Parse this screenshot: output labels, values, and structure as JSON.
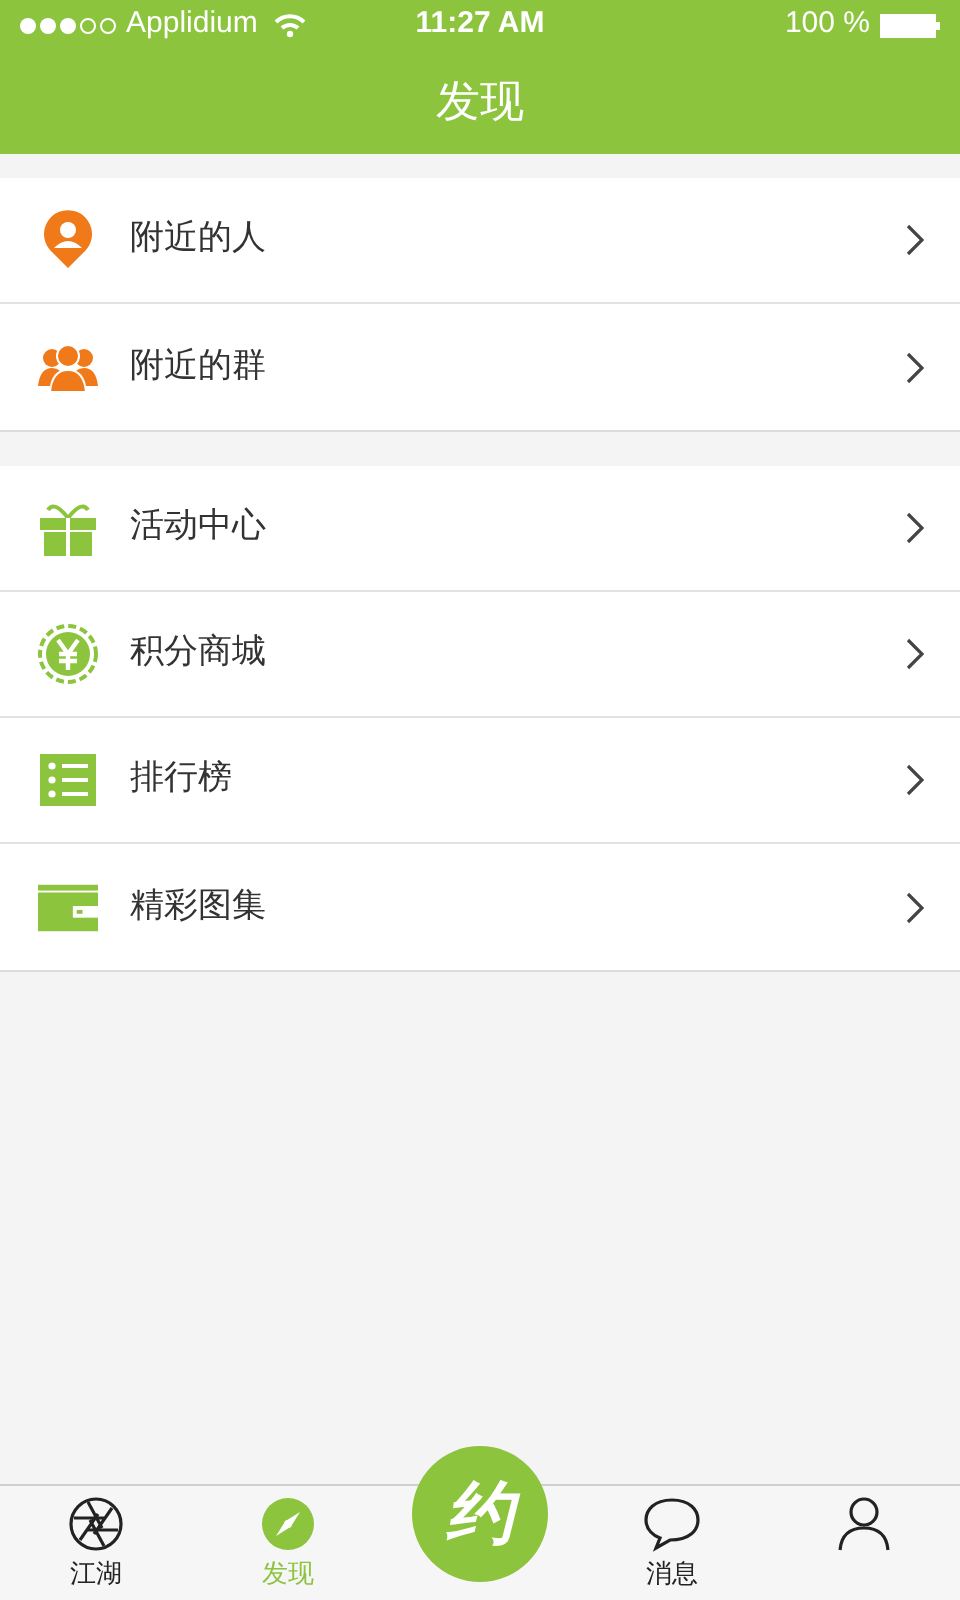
{
  "status_bar": {
    "carrier": "Applidium",
    "time": "11:27 AM",
    "battery": "100 %"
  },
  "nav_bar": {
    "title": "发现"
  },
  "sections": [
    {
      "items": [
        {
          "label": "附近的人"
        },
        {
          "label": "附近的群"
        }
      ]
    },
    {
      "items": [
        {
          "label": "活动中心"
        },
        {
          "label": "积分商城"
        },
        {
          "label": "排行榜"
        },
        {
          "label": "精彩图集"
        }
      ]
    }
  ],
  "tab_bar": {
    "tabs": [
      {
        "kind": "tab",
        "label": "江湖",
        "selected": false
      },
      {
        "kind": "tab",
        "label": "发现",
        "selected": true
      },
      {
        "kind": "center",
        "label": "约"
      },
      {
        "kind": "tab",
        "label": "消息",
        "selected": false
      },
      {
        "kind": "tab",
        "selected": false
      }
    ]
  }
}
